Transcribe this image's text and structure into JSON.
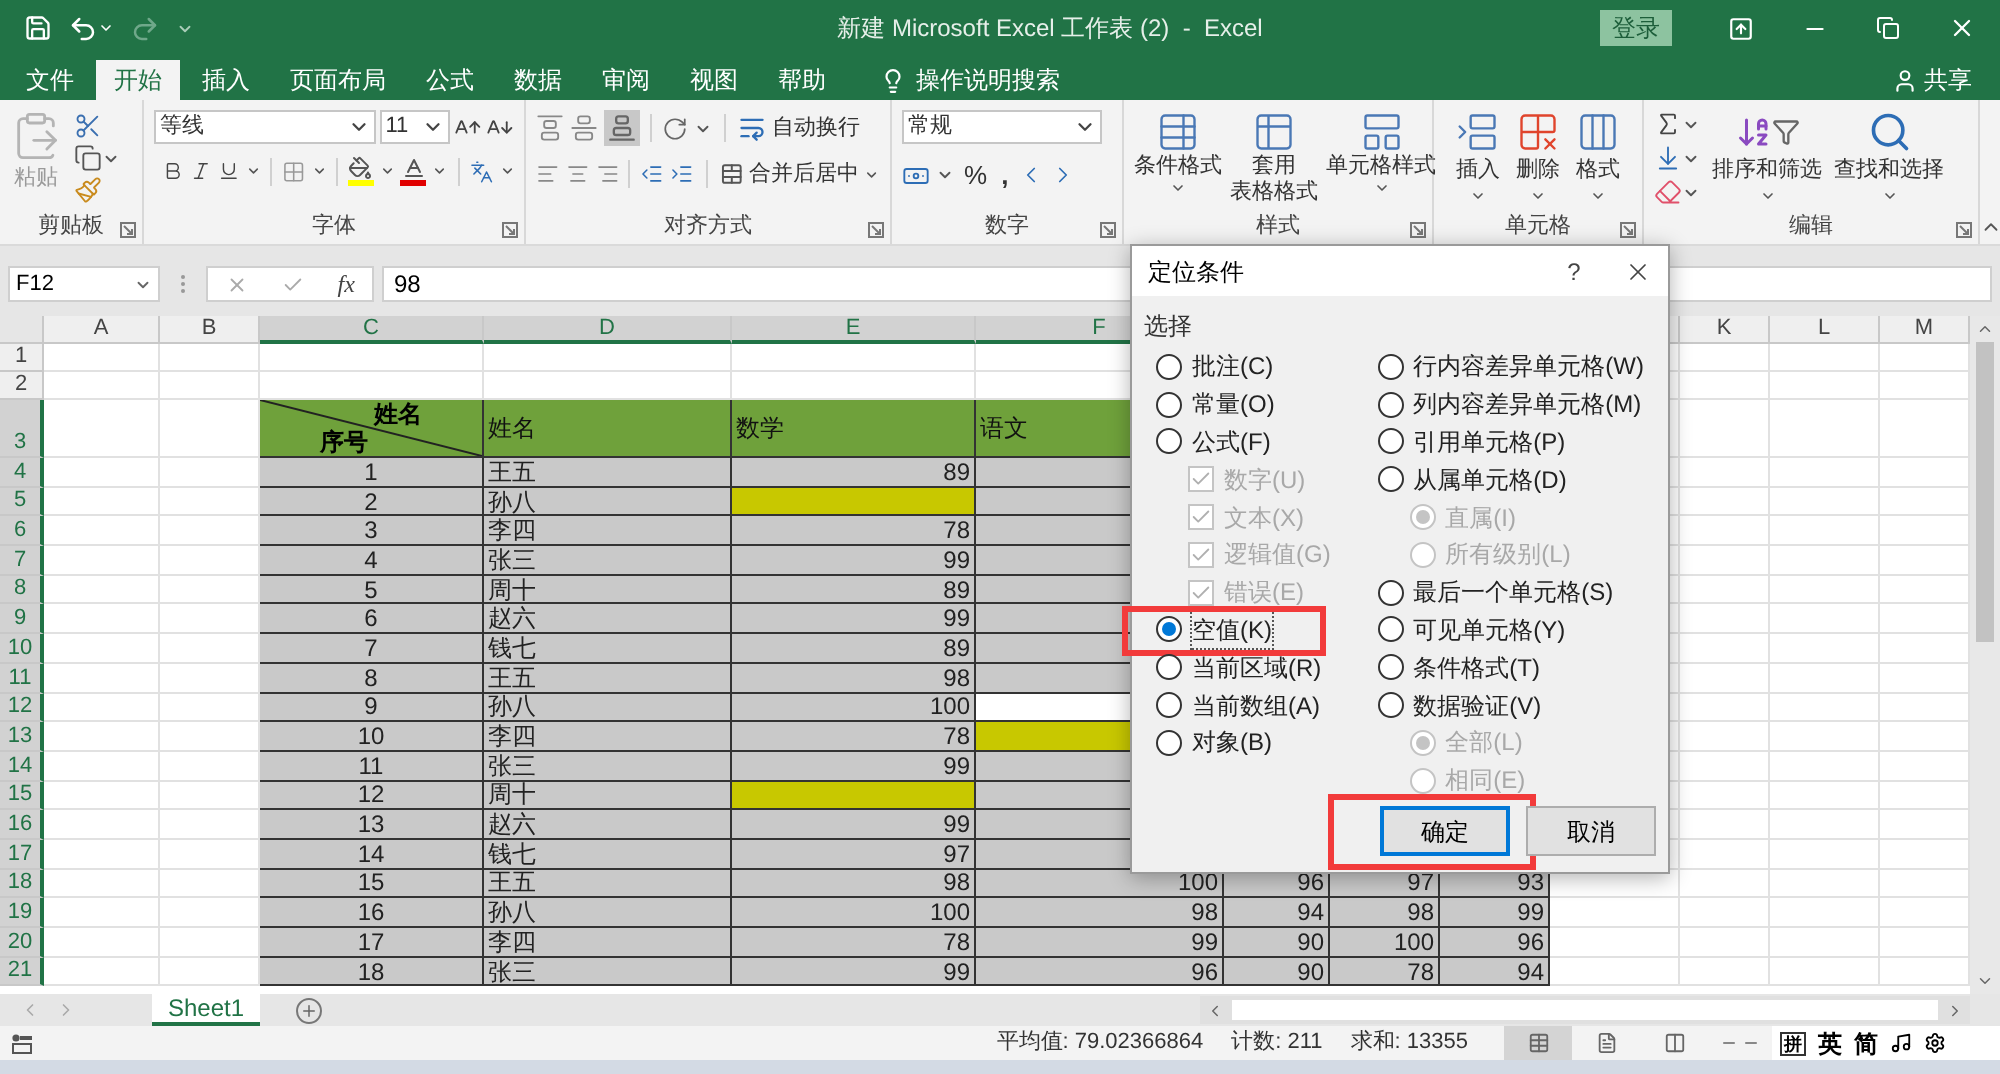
{
  "title_bar": {
    "title": "新建 Microsoft Excel 工作表 (2)  -  Excel",
    "sign_in": "登录"
  },
  "ribbon_tabs": [
    {
      "label": "文件",
      "selected": false
    },
    {
      "label": "开始",
      "selected": true
    },
    {
      "label": "插入",
      "selected": false
    },
    {
      "label": "页面布局",
      "selected": false
    },
    {
      "label": "公式",
      "selected": false
    },
    {
      "label": "数据",
      "selected": false
    },
    {
      "label": "审阅",
      "selected": false
    },
    {
      "label": "视图",
      "selected": false
    },
    {
      "label": "帮助",
      "selected": false
    }
  ],
  "tell_me": "操作说明搜索",
  "share": "共享",
  "ribbon": {
    "clipboard": {
      "label": "剪贴板",
      "paste": "粘贴",
      "paste_disabled": true
    },
    "font": {
      "label": "字体",
      "font": "等线",
      "size": "11"
    },
    "alignment": {
      "label": "对齐方式",
      "wrap": "自动换行",
      "merge": "合并后居中"
    },
    "number": {
      "label": "数字",
      "format": "常规",
      "percent": "%",
      "comma": ","
    },
    "styles": {
      "label": "样式",
      "buttons": [
        {
          "kind": "conditional",
          "lines": [
            "条件格式"
          ]
        },
        {
          "kind": "table",
          "lines": [
            "套用",
            "表格格式"
          ]
        },
        {
          "kind": "cell",
          "lines": [
            "单元格样式"
          ]
        }
      ]
    },
    "cells": {
      "label": "单元格",
      "buttons": [
        {
          "kind": "insert",
          "label": "插入"
        },
        {
          "kind": "delete",
          "label": "删除"
        },
        {
          "kind": "format",
          "label": "格式"
        }
      ]
    },
    "editing": {
      "label": "编辑",
      "sort": "排序和筛选",
      "find": "查找和选择"
    }
  },
  "formula_bar": {
    "name_box": "F12",
    "function_label": "fx",
    "value": "98"
  },
  "columns": [
    {
      "label": "A",
      "selected": false
    },
    {
      "label": "B",
      "selected": false
    },
    {
      "label": "C",
      "selected": true
    },
    {
      "label": "D",
      "selected": true
    },
    {
      "label": "E",
      "selected": true
    },
    {
      "label": "F",
      "selected": true
    },
    {
      "label": "K",
      "selected": false
    },
    {
      "label": "L",
      "selected": false
    },
    {
      "label": "M",
      "selected": false
    }
  ],
  "rows": [
    {
      "header": "1",
      "selected": false,
      "kind": "blank"
    },
    {
      "header": "2",
      "selected": false,
      "kind": "blank"
    },
    {
      "header": "3",
      "selected": true,
      "kind": "header",
      "corner_top": "姓名",
      "corner_bottom": "序号",
      "cells": [
        {
          "text": "姓名"
        },
        {
          "text": "数学"
        },
        {
          "text": "语文"
        }
      ]
    },
    {
      "header": "4",
      "selected": true,
      "kind": "data",
      "cells": [
        {
          "text": "1",
          "color": "#c9c9c9"
        },
        {
          "text": "王五",
          "color": "#c9c9c9"
        },
        {
          "text": "89",
          "color": "#c9c9c9"
        },
        {
          "color": "#c9c9c9"
        }
      ]
    },
    {
      "header": "5",
      "selected": true,
      "kind": "data",
      "cells": [
        {
          "text": "2",
          "color": "#c9c9c9"
        },
        {
          "text": "孙八",
          "color": "#c9c9c9"
        },
        {
          "color": "#c8c800"
        },
        {
          "color": "#c9c9c9"
        }
      ]
    },
    {
      "header": "6",
      "selected": true,
      "kind": "data",
      "cells": [
        {
          "text": "3",
          "color": "#c9c9c9"
        },
        {
          "text": "李四",
          "color": "#c9c9c9"
        },
        {
          "text": "78",
          "color": "#c9c9c9"
        },
        {
          "color": "#c9c9c9"
        }
      ]
    },
    {
      "header": "7",
      "selected": true,
      "kind": "data",
      "cells": [
        {
          "text": "4",
          "color": "#c9c9c9"
        },
        {
          "text": "张三",
          "color": "#c9c9c9"
        },
        {
          "text": "99",
          "color": "#c9c9c9"
        },
        {
          "color": "#c9c9c9"
        }
      ]
    },
    {
      "header": "8",
      "selected": true,
      "kind": "data",
      "cells": [
        {
          "text": "5",
          "color": "#c9c9c9"
        },
        {
          "text": "周十",
          "color": "#c9c9c9"
        },
        {
          "text": "89",
          "color": "#c9c9c9"
        },
        {
          "color": "#c9c9c9"
        }
      ]
    },
    {
      "header": "9",
      "selected": true,
      "kind": "data",
      "cells": [
        {
          "text": "6",
          "color": "#c9c9c9"
        },
        {
          "text": "赵六",
          "color": "#c9c9c9"
        },
        {
          "text": "99",
          "color": "#c9c9c9"
        },
        {
          "color": "#c9c9c9"
        }
      ]
    },
    {
      "header": "10",
      "selected": true,
      "kind": "data",
      "cells": [
        {
          "text": "7",
          "color": "#c9c9c9"
        },
        {
          "text": "钱七",
          "color": "#c9c9c9"
        },
        {
          "text": "89",
          "color": "#c9c9c9"
        },
        {
          "color": "#c9c9c9"
        }
      ]
    },
    {
      "header": "11",
      "selected": true,
      "kind": "data",
      "cells": [
        {
          "text": "8",
          "color": "#c9c9c9"
        },
        {
          "text": "王五",
          "color": "#c9c9c9"
        },
        {
          "text": "98",
          "color": "#c9c9c9"
        },
        {
          "color": "#c9c9c9"
        }
      ]
    },
    {
      "header": "12",
      "selected": true,
      "kind": "data",
      "cells": [
        {
          "text": "9",
          "color": "#c9c9c9"
        },
        {
          "text": "孙八",
          "color": "#c9c9c9"
        },
        {
          "text": "100",
          "color": "#c9c9c9"
        },
        {
          "color": "#ffffff"
        }
      ]
    },
    {
      "header": "13",
      "selected": true,
      "kind": "data",
      "cells": [
        {
          "text": "10",
          "color": "#c9c9c9"
        },
        {
          "text": "李四",
          "color": "#c9c9c9"
        },
        {
          "text": "78",
          "color": "#c9c9c9"
        },
        {
          "color": "#c8c800"
        }
      ]
    },
    {
      "header": "14",
      "selected": true,
      "kind": "data",
      "cells": [
        {
          "text": "11",
          "color": "#c9c9c9"
        },
        {
          "text": "张三",
          "color": "#c9c9c9"
        },
        {
          "text": "99",
          "color": "#c9c9c9"
        },
        {
          "color": "#c9c9c9"
        }
      ]
    },
    {
      "header": "15",
      "selected": true,
      "kind": "data",
      "cells": [
        {
          "text": "12",
          "color": "#c9c9c9"
        },
        {
          "text": "周十",
          "color": "#c9c9c9"
        },
        {
          "color": "#c8c800"
        },
        {
          "color": "#c9c9c9"
        }
      ]
    },
    {
      "header": "16",
      "selected": true,
      "kind": "data",
      "cells": [
        {
          "text": "13",
          "color": "#c9c9c9"
        },
        {
          "text": "赵六",
          "color": "#c9c9c9"
        },
        {
          "text": "99",
          "color": "#c9c9c9"
        },
        {
          "color": "#c9c9c9"
        }
      ]
    },
    {
      "header": "17",
      "selected": true,
      "kind": "data",
      "cells": [
        {
          "text": "14",
          "color": "#c9c9c9"
        },
        {
          "text": "钱七",
          "color": "#c9c9c9"
        },
        {
          "text": "97",
          "color": "#c9c9c9"
        },
        {
          "color": "#c9c9c9"
        }
      ]
    },
    {
      "header": "18",
      "selected": true,
      "kind": "data",
      "cells": [
        {
          "text": "15",
          "color": "#c9c9c9"
        },
        {
          "text": "王五",
          "color": "#c9c9c9"
        },
        {
          "text": "98",
          "color": "#c9c9c9"
        },
        {
          "text": "100",
          "color": "#c9c9c9"
        },
        {
          "text": "96",
          "color": "#c9c9c9"
        },
        {
          "text": "97",
          "color": "#c9c9c9"
        },
        {
          "text": "93",
          "color": "#c9c9c9"
        }
      ]
    },
    {
      "header": "19",
      "selected": true,
      "kind": "data",
      "cells": [
        {
          "text": "16",
          "color": "#c9c9c9"
        },
        {
          "text": "孙八",
          "color": "#c9c9c9"
        },
        {
          "text": "100",
          "color": "#c9c9c9"
        },
        {
          "text": "98",
          "color": "#c9c9c9"
        },
        {
          "text": "94",
          "color": "#c9c9c9"
        },
        {
          "text": "98",
          "color": "#c9c9c9"
        },
        {
          "text": "99",
          "color": "#c9c9c9"
        }
      ]
    },
    {
      "header": "20",
      "selected": true,
      "kind": "data",
      "cells": [
        {
          "text": "17",
          "color": "#c9c9c9"
        },
        {
          "text": "李四",
          "color": "#c9c9c9"
        },
        {
          "text": "78",
          "color": "#c9c9c9"
        },
        {
          "text": "99",
          "color": "#c9c9c9"
        },
        {
          "text": "90",
          "color": "#c9c9c9"
        },
        {
          "text": "100",
          "color": "#c9c9c9"
        },
        {
          "text": "96",
          "color": "#c9c9c9"
        }
      ]
    },
    {
      "header": "21",
      "selected": true,
      "kind": "data",
      "cells": [
        {
          "text": "18",
          "color": "#c9c9c9"
        },
        {
          "text": "张三",
          "color": "#c9c9c9"
        },
        {
          "text": "99",
          "color": "#c9c9c9"
        },
        {
          "text": "96",
          "color": "#c9c9c9"
        },
        {
          "text": "90",
          "color": "#c9c9c9"
        },
        {
          "text": "78",
          "color": "#c9c9c9"
        },
        {
          "text": "94",
          "color": "#c9c9c9"
        }
      ]
    }
  ],
  "sheet_tabs": [
    {
      "label": "Sheet1",
      "selected": true
    }
  ],
  "status_bar": {
    "stats": [
      "平均值: 79.02366864",
      "计数: 211",
      "求和: 13355"
    ],
    "views": [
      {
        "kind": "normal",
        "selected": true
      },
      {
        "kind": "page_layout",
        "selected": false
      },
      {
        "kind": "page_break",
        "selected": false
      }
    ],
    "ime": [
      "拼",
      "英",
      "简"
    ]
  },
  "dialog": {
    "title": "定位条件",
    "help": "?",
    "group_label": "选择",
    "left_options": [
      {
        "kind": "radio",
        "label": "批注(C)",
        "selected": false,
        "disabled": false,
        "highlighted": false
      },
      {
        "kind": "radio",
        "label": "常量(O)",
        "selected": false,
        "disabled": false,
        "highlighted": false
      },
      {
        "kind": "radio",
        "label": "公式(F)",
        "selected": false,
        "disabled": false,
        "highlighted": false,
        "children": [
          {
            "kind": "checkbox",
            "label": "数字(U)",
            "checked": true,
            "disabled": true
          },
          {
            "kind": "checkbox",
            "label": "文本(X)",
            "checked": true,
            "disabled": true
          },
          {
            "kind": "checkbox",
            "label": "逻辑值(G)",
            "checked": true,
            "disabled": true
          },
          {
            "kind": "checkbox",
            "label": "错误(E)",
            "checked": true,
            "disabled": true
          }
        ]
      },
      {
        "kind": "radio",
        "label": "空值(K)",
        "selected": true,
        "disabled": false,
        "highlighted": true
      },
      {
        "kind": "radio",
        "label": "当前区域(R)",
        "selected": false,
        "disabled": false,
        "highlighted": false
      },
      {
        "kind": "radio",
        "label": "当前数组(A)",
        "selected": false,
        "disabled": false,
        "highlighted": false
      },
      {
        "kind": "radio",
        "label": "对象(B)",
        "selected": false,
        "disabled": false,
        "highlighted": false
      }
    ],
    "right_options": [
      {
        "kind": "radio",
        "label": "行内容差异单元格(W)",
        "selected": false,
        "disabled": false,
        "highlighted": false
      },
      {
        "kind": "radio",
        "label": "列内容差异单元格(M)",
        "selected": false,
        "disabled": false,
        "highlighted": false
      },
      {
        "kind": "radio",
        "label": "引用单元格(P)",
        "selected": false,
        "disabled": false,
        "highlighted": false
      },
      {
        "kind": "radio",
        "label": "从属单元格(D)",
        "selected": false,
        "disabled": false,
        "highlighted": false,
        "children": [
          {
            "kind": "radio",
            "label": "直属(I)",
            "selected": true,
            "disabled": true,
            "highlighted": false
          },
          {
            "kind": "radio",
            "label": "所有级别(L)",
            "selected": false,
            "disabled": true,
            "highlighted": false
          }
        ]
      },
      {
        "kind": "radio",
        "label": "最后一个单元格(S)",
        "selected": false,
        "disabled": false,
        "highlighted": false
      },
      {
        "kind": "radio",
        "label": "可见单元格(Y)",
        "selected": false,
        "disabled": false,
        "highlighted": false
      },
      {
        "kind": "radio",
        "label": "条件格式(T)",
        "selected": false,
        "disabled": false,
        "highlighted": false
      },
      {
        "kind": "radio",
        "label": "数据验证(V)",
        "selected": false,
        "disabled": false,
        "highlighted": false,
        "children": [
          {
            "kind": "radio",
            "label": "全部(L)",
            "selected": true,
            "disabled": true,
            "highlighted": false
          },
          {
            "kind": "radio",
            "label": "相同(E)",
            "selected": false,
            "disabled": true,
            "highlighted": false
          }
        ]
      }
    ],
    "buttons": [
      {
        "label": "确定",
        "default": true,
        "highlighted": true
      },
      {
        "label": "取消",
        "default": false
      }
    ]
  }
}
